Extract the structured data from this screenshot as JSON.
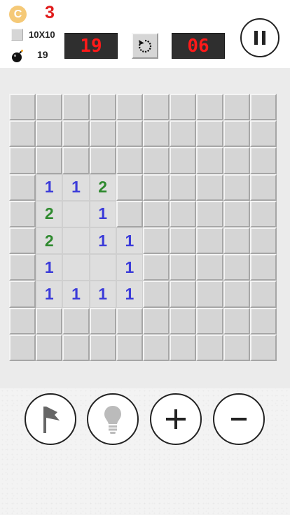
{
  "status": {
    "coin_symbol": "C",
    "coin_count": "3",
    "grid_size": "10X10",
    "mine_total": "19"
  },
  "counters": {
    "mines_left": "19",
    "time": "06"
  },
  "icons": {
    "coin": "coin-icon",
    "size": "square-icon",
    "bomb": "bomb-icon",
    "restart": "restart-icon",
    "pause": "pause-icon",
    "flag": "flag-icon",
    "hint": "lightbulb-icon",
    "zoom_in": "plus-icon",
    "zoom_out": "minus-icon"
  },
  "colors": {
    "counter_digits": "#ff1a1a",
    "coin": "#f5c977",
    "number_1": "#3b3bd9",
    "number_2": "#2f8a2f"
  },
  "board": {
    "rows": [
      [
        "H",
        "H",
        "H",
        "H",
        "H",
        "H",
        "H",
        "H",
        "H",
        "H"
      ],
      [
        "H",
        "H",
        "H",
        "H",
        "H",
        "H",
        "H",
        "H",
        "H",
        "H"
      ],
      [
        "H",
        "H",
        "H",
        "H",
        "H",
        "H",
        "H",
        "H",
        "H",
        "H"
      ],
      [
        "H",
        "1",
        "1",
        "2",
        "H",
        "H",
        "H",
        "H",
        "H",
        "H"
      ],
      [
        "H",
        "2",
        "0",
        "1",
        "H",
        "H",
        "H",
        "H",
        "H",
        "H"
      ],
      [
        "H",
        "2",
        "0",
        "1",
        "1",
        "H",
        "H",
        "H",
        "H",
        "H"
      ],
      [
        "H",
        "1",
        "0",
        "0",
        "1",
        "H",
        "H",
        "H",
        "H",
        "H"
      ],
      [
        "H",
        "1",
        "1",
        "1",
        "1",
        "H",
        "H",
        "H",
        "H",
        "H"
      ],
      [
        "H",
        "H",
        "H",
        "H",
        "H",
        "H",
        "H",
        "H",
        "H",
        "H"
      ],
      [
        "H",
        "H",
        "H",
        "H",
        "H",
        "H",
        "H",
        "H",
        "H",
        "H"
      ]
    ]
  }
}
